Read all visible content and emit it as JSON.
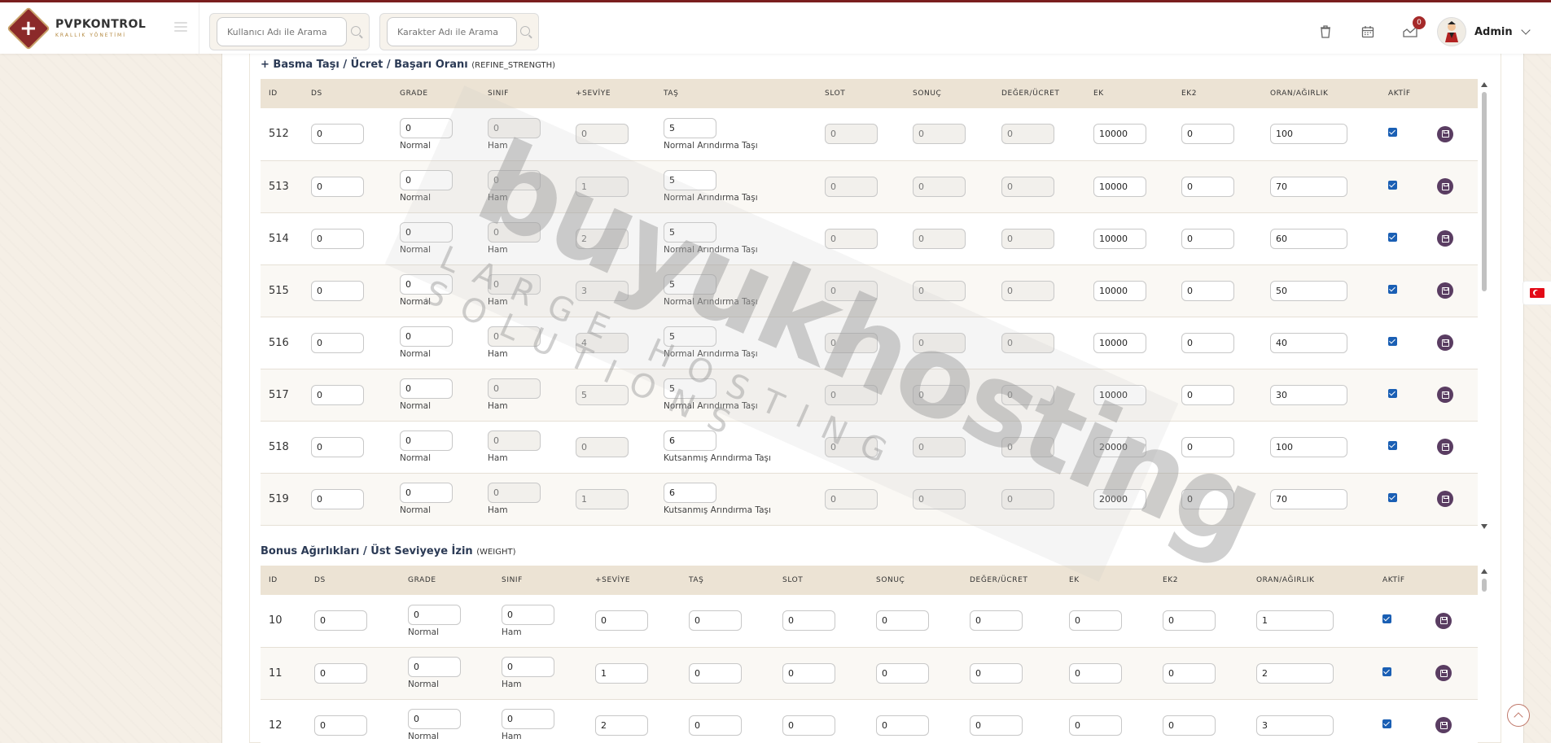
{
  "brand": {
    "title": "PVPKONTROL",
    "subtitle": "KRALLIK YÖNETİMİ"
  },
  "search": {
    "user_placeholder": "Kullanıcı Adı ile Arama",
    "char_placeholder": "Karakter Adı ile Arama"
  },
  "header": {
    "notification_count": "0",
    "user_name": "Admin"
  },
  "section1": {
    "title": "+ Basma Taşı / Ücret / Başarı Oranı",
    "code": "(REFINE_STRENGTH)",
    "columns": [
      "ID",
      "DS",
      "GRADE",
      "SINIF",
      "+SEVİYE",
      "TAŞ",
      "SLOT",
      "SONUÇ",
      "DEĞER/ÜCRET",
      "EK",
      "EK2",
      "ORAN/AĞIRLIK",
      "AKTİF"
    ],
    "rows": [
      {
        "id": "512",
        "ds": "0",
        "grade": "0",
        "grade_label": "Normal",
        "sinif": "0",
        "sinif_label": "Ham",
        "seviye": "0",
        "tas": "5",
        "tas_label": "Normal Arındırma Taşı",
        "slot": "0",
        "sonuc": "0",
        "deger": "0",
        "ek": "10000",
        "ek2": "0",
        "oran": "100"
      },
      {
        "id": "513",
        "ds": "0",
        "grade": "0",
        "grade_label": "Normal",
        "sinif": "0",
        "sinif_label": "Ham",
        "seviye": "1",
        "tas": "5",
        "tas_label": "Normal Arındırma Taşı",
        "slot": "0",
        "sonuc": "0",
        "deger": "0",
        "ek": "10000",
        "ek2": "0",
        "oran": "70"
      },
      {
        "id": "514",
        "ds": "0",
        "grade": "0",
        "grade_label": "Normal",
        "sinif": "0",
        "sinif_label": "Ham",
        "seviye": "2",
        "tas": "5",
        "tas_label": "Normal Arındırma Taşı",
        "slot": "0",
        "sonuc": "0",
        "deger": "0",
        "ek": "10000",
        "ek2": "0",
        "oran": "60"
      },
      {
        "id": "515",
        "ds": "0",
        "grade": "0",
        "grade_label": "Normal",
        "sinif": "0",
        "sinif_label": "Ham",
        "seviye": "3",
        "tas": "5",
        "tas_label": "Normal Arındırma Taşı",
        "slot": "0",
        "sonuc": "0",
        "deger": "0",
        "ek": "10000",
        "ek2": "0",
        "oran": "50"
      },
      {
        "id": "516",
        "ds": "0",
        "grade": "0",
        "grade_label": "Normal",
        "sinif": "0",
        "sinif_label": "Ham",
        "seviye": "4",
        "tas": "5",
        "tas_label": "Normal Arındırma Taşı",
        "slot": "0",
        "sonuc": "0",
        "deger": "0",
        "ek": "10000",
        "ek2": "0",
        "oran": "40"
      },
      {
        "id": "517",
        "ds": "0",
        "grade": "0",
        "grade_label": "Normal",
        "sinif": "0",
        "sinif_label": "Ham",
        "seviye": "5",
        "tas": "5",
        "tas_label": "Normal Arındırma Taşı",
        "slot": "0",
        "sonuc": "0",
        "deger": "0",
        "ek": "10000",
        "ek2": "0",
        "oran": "30"
      },
      {
        "id": "518",
        "ds": "0",
        "grade": "0",
        "grade_label": "Normal",
        "sinif": "0",
        "sinif_label": "Ham",
        "seviye": "0",
        "tas": "6",
        "tas_label": "Kutsanmış Arındırma Taşı",
        "slot": "0",
        "sonuc": "0",
        "deger": "0",
        "ek": "20000",
        "ek2": "0",
        "oran": "100"
      },
      {
        "id": "519",
        "ds": "0",
        "grade": "0",
        "grade_label": "Normal",
        "sinif": "0",
        "sinif_label": "Ham",
        "seviye": "1",
        "tas": "6",
        "tas_label": "Kutsanmış Arındırma Taşı",
        "slot": "0",
        "sonuc": "0",
        "deger": "0",
        "ek": "20000",
        "ek2": "0",
        "oran": "70"
      }
    ]
  },
  "section2": {
    "title": "Bonus Ağırlıkları / Üst Seviyeye İzin",
    "code": "(WEIGHT)",
    "columns": [
      "ID",
      "DS",
      "GRADE",
      "SINIF",
      "+SEVİYE",
      "TAŞ",
      "SLOT",
      "SONUÇ",
      "DEĞER/ÜCRET",
      "EK",
      "EK2",
      "ORAN/AĞIRLIK",
      "AKTİF"
    ],
    "rows": [
      {
        "id": "10",
        "ds": "0",
        "grade": "0",
        "grade_label": "Normal",
        "sinif": "0",
        "sinif_label": "Ham",
        "seviye": "0",
        "tas": "0",
        "slot": "0",
        "sonuc": "0",
        "deger": "0",
        "ek": "0",
        "ek2": "0",
        "oran": "1"
      },
      {
        "id": "11",
        "ds": "0",
        "grade": "0",
        "grade_label": "Normal",
        "sinif": "0",
        "sinif_label": "Ham",
        "seviye": "1",
        "tas": "0",
        "slot": "0",
        "sonuc": "0",
        "deger": "0",
        "ek": "0",
        "ek2": "0",
        "oran": "2"
      },
      {
        "id": "12",
        "ds": "0",
        "grade": "0",
        "grade_label": "Normal",
        "sinif": "0",
        "sinif_label": "Ham",
        "seviye": "2",
        "tas": "0",
        "slot": "0",
        "sonuc": "0",
        "deger": "0",
        "ek": "0",
        "ek2": "0",
        "oran": "3"
      }
    ]
  },
  "watermark": {
    "main": "buyukhosting",
    "sub": "LARGE HOSTING SOLUTIONS"
  }
}
